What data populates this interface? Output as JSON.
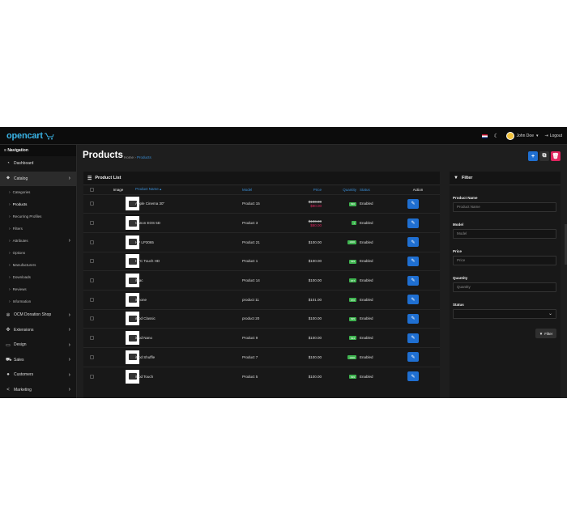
{
  "header": {
    "logo_text": "opencart",
    "user_name": "John Doe",
    "logout_label": "Logout",
    "theme_icon": "moon-icon",
    "flag_icon": "gb-flag-icon"
  },
  "sidebar": {
    "title": "Navigation",
    "items": [
      {
        "label": "Dashboard",
        "icon": "dashboard-icon"
      },
      {
        "label": "Catalog",
        "icon": "tag-icon"
      },
      {
        "label": "OCM Donation Shop",
        "icon": "gear-icon"
      },
      {
        "label": "Extensions",
        "icon": "puzzle-icon"
      },
      {
        "label": "Design",
        "icon": "monitor-icon"
      },
      {
        "label": "Sales",
        "icon": "cart-icon"
      },
      {
        "label": "Customers",
        "icon": "user-icon"
      },
      {
        "label": "Marketing",
        "icon": "share-icon"
      }
    ],
    "catalog_sub": [
      {
        "label": "Categories"
      },
      {
        "label": "Products"
      },
      {
        "label": "Recurring Profiles"
      },
      {
        "label": "Filters"
      },
      {
        "label": "Attributes"
      },
      {
        "label": "Options"
      },
      {
        "label": "Manufacturers"
      },
      {
        "label": "Downloads"
      },
      {
        "label": "Reviews"
      },
      {
        "label": "Information"
      }
    ]
  },
  "page": {
    "title": "Products",
    "breadcrumb_home": "Home",
    "breadcrumb_sep": "›",
    "breadcrumb_current": "Products"
  },
  "list": {
    "title": "Product List",
    "columns": {
      "image": "Image",
      "name": "Product Name",
      "model": "Model",
      "price": "Price",
      "quantity": "Quantity",
      "status": "Status",
      "action": "Action"
    },
    "rows": [
      {
        "name": "Apple Cinema 30\"",
        "model": "Product 15",
        "price": "$100.00",
        "special": "$90.00",
        "quantity": "990",
        "status": "Enabled"
      },
      {
        "name": "Canon EOS 5D",
        "model": "Product 3",
        "price": "$100.00",
        "special": "$80.00",
        "quantity": "7",
        "status": "Enabled"
      },
      {
        "name": "HP LP3065",
        "model": "Product 21",
        "price": "$100.00",
        "special": "",
        "quantity": "1000",
        "status": "Enabled"
      },
      {
        "name": "HTC Touch HD",
        "model": "Product 1",
        "price": "$100.00",
        "special": "",
        "quantity": "939",
        "status": "Enabled"
      },
      {
        "name": "iMac",
        "model": "Product 14",
        "price": "$100.00",
        "special": "",
        "quantity": "977",
        "status": "Enabled"
      },
      {
        "name": "iPhone",
        "model": "product 11",
        "price": "$101.00",
        "special": "",
        "quantity": "970",
        "status": "Enabled"
      },
      {
        "name": "iPod Classic",
        "model": "product 20",
        "price": "$100.00",
        "special": "",
        "quantity": "995",
        "status": "Enabled"
      },
      {
        "name": "iPod Nano",
        "model": "Product 9",
        "price": "$100.00",
        "special": "",
        "quantity": "994",
        "status": "Enabled"
      },
      {
        "name": "iPod Shuffle",
        "model": "Product 7",
        "price": "$100.00",
        "special": "",
        "quantity": "1000",
        "status": "Enabled"
      },
      {
        "name": "iPod Touch",
        "model": "Product 5",
        "price": "$100.00",
        "special": "",
        "quantity": "999",
        "status": "Enabled"
      }
    ]
  },
  "filter": {
    "title": "Filter",
    "name_label": "Product Name",
    "name_placeholder": "Product Name",
    "model_label": "Model",
    "model_placeholder": "Model",
    "price_label": "Price",
    "price_placeholder": "Price",
    "quantity_label": "Quantity",
    "quantity_placeholder": "Quantity",
    "status_label": "Status",
    "button_label": "Filter"
  },
  "colors": {
    "accent": "#1f6fd1",
    "danger": "#e0245e",
    "success": "#3fb550",
    "link": "#3a8ed6"
  }
}
